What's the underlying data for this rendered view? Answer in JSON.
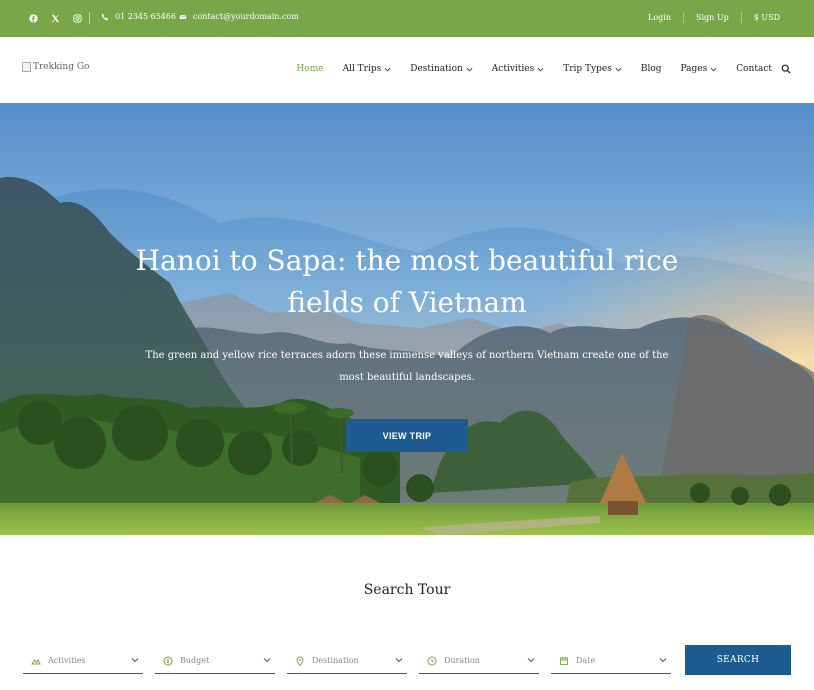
{
  "topbar": {
    "social": [
      "facebook-icon",
      "x-twitter-icon",
      "instagram-icon"
    ],
    "phone": "01 2345 65466",
    "email": "contact@yourdomain.com",
    "links": [
      "Login",
      "Sign Up",
      "$ USD"
    ]
  },
  "header": {
    "logo_alt": "Trekking Go",
    "nav": [
      {
        "label": "Home",
        "active": true,
        "dropdown": false
      },
      {
        "label": "All Trips",
        "active": false,
        "dropdown": true
      },
      {
        "label": "Destination",
        "active": false,
        "dropdown": true
      },
      {
        "label": "Activities",
        "active": false,
        "dropdown": true
      },
      {
        "label": "Trip Types",
        "active": false,
        "dropdown": true
      },
      {
        "label": "Blog",
        "active": false,
        "dropdown": false
      },
      {
        "label": "Pages",
        "active": false,
        "dropdown": true
      },
      {
        "label": "Contact",
        "active": false,
        "dropdown": false
      }
    ]
  },
  "hero": {
    "title_line1": "Hanoi to Sapa: the most beautiful rice",
    "title_line2": "fields of Vietnam",
    "subtitle": "The green and yellow rice terraces adorn these immense valleys of northern Vietnam create one of the most beautiful landscapes.",
    "button": "VIEW TRIP"
  },
  "search": {
    "title": "Search Tour",
    "fields": [
      {
        "placeholder": "Activities",
        "icon": "activities-icon"
      },
      {
        "placeholder": "Budget",
        "icon": "budget-icon"
      },
      {
        "placeholder": "Destination",
        "icon": "location-pin-icon"
      },
      {
        "placeholder": "Duration",
        "icon": "clock-icon"
      },
      {
        "placeholder": "Date",
        "icon": "calendar-icon"
      }
    ],
    "button": "SEARCH"
  },
  "colors": {
    "topbar": "#79a649",
    "accent": "#79a649",
    "button": "#1d5b91"
  }
}
